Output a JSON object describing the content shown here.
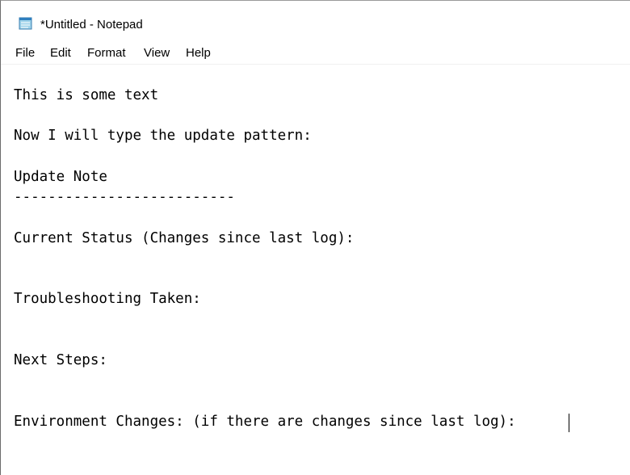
{
  "window": {
    "title": "*Untitled - Notepad",
    "app_icon": "notepad-icon"
  },
  "menu": {
    "items": [
      "File",
      "Edit",
      "Format",
      "View",
      "Help"
    ]
  },
  "editor": {
    "lines": [
      "This is some text",
      "Now I will type the update pattern:",
      "Update Note",
      "--------------------------",
      "Current Status (Changes since last log):",
      "Troubleshooting Taken:",
      "Next Steps:",
      "Environment Changes: (if there are changes since last log):"
    ]
  }
}
